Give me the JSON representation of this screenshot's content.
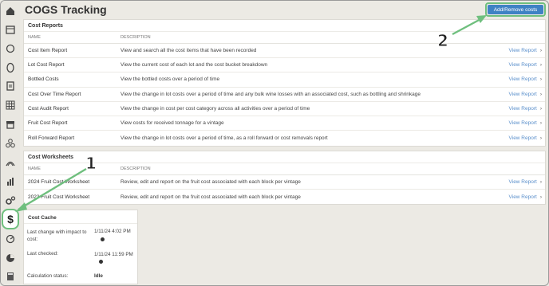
{
  "page": {
    "title": "COGS Tracking",
    "add_button": "Add/Remove costs"
  },
  "sidebar": {
    "icons": [
      "home-icon",
      "calendar-icon",
      "circle-icon",
      "barrel-icon",
      "clipboard-icon",
      "grid-icon",
      "archive-icon",
      "barrels-icon",
      "vineyard-icon",
      "bar-chart-icon",
      "gears-icon",
      "dollar-icon",
      "gauge-icon",
      "pie-chart-icon",
      "calculator-icon"
    ],
    "active": "$"
  },
  "cost_reports": {
    "title": "Cost Reports",
    "col_name": "NAME",
    "col_desc": "DESCRIPTION",
    "rows": [
      {
        "name": "Cost Item Report",
        "desc": "View and search all the cost items that have been recorded",
        "link": "View Report"
      },
      {
        "name": "Lot Cost Report",
        "desc": "View the current cost of each lot and the cost bucket breakdown",
        "link": "View Report"
      },
      {
        "name": "Bottled Costs",
        "desc": "View the bottled costs over a period of time",
        "link": "View Report"
      },
      {
        "name": "Cost Over Time Report",
        "desc": "View the change in lot costs over a period of time and any bulk wine losses with an associated cost, such as bottling and shrinkage",
        "link": "View Report"
      },
      {
        "name": "Cost Audit Report",
        "desc": "View the change in cost per cost category across all activities over a period of time",
        "link": "View Report"
      },
      {
        "name": "Fruit Cost Report",
        "desc": "View costs for received tonnage for a vintage",
        "link": "View Report"
      },
      {
        "name": "Roll Forward Report",
        "desc": "View the change in lot costs over a period of time, as a roll forward or cost removals report",
        "link": "View Report"
      }
    ]
  },
  "cost_worksheets": {
    "title": "Cost Worksheets",
    "col_name": "NAME",
    "col_desc": "DESCRIPTION",
    "rows": [
      {
        "name": "2024 Fruit Cost Worksheet",
        "desc": "Review, edit and report on the fruit cost associated with each block per vintage",
        "link": "View Report"
      },
      {
        "name": "2023 Fruit Cost Worksheet",
        "desc": "Review, edit and report on the fruit cost associated with each block per vintage",
        "link": "View Report"
      }
    ]
  },
  "cost_cache": {
    "title": "Cost Cache",
    "last_change_label": "Last change with impact to cost:",
    "last_change_value": "1/11/24 4:02 PM",
    "last_checked_label": "Last checked:",
    "last_checked_value": "1/11/24 11:59 PM",
    "status_label": "Calculation status:",
    "status_value": "Idle"
  },
  "annotations": {
    "one": "1",
    "two": "2",
    "color": "#6fbf7e"
  }
}
